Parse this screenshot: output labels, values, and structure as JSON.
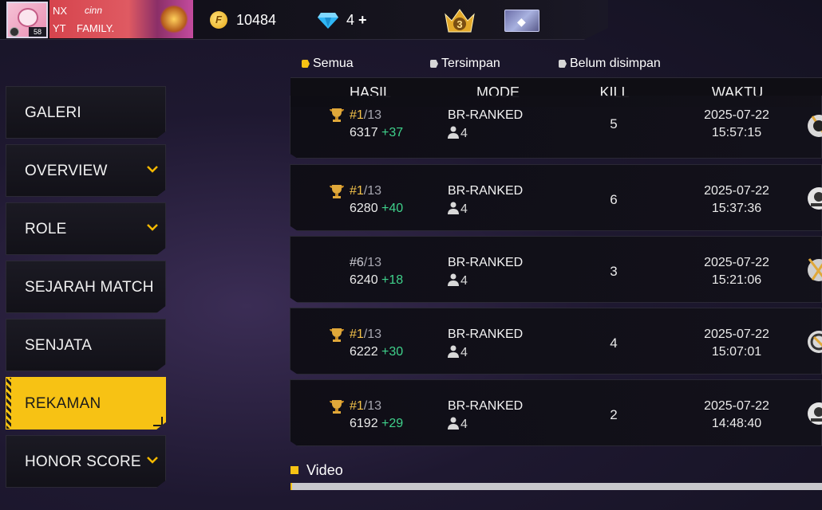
{
  "header": {
    "level": "58",
    "banner": {
      "line1_left": "NX",
      "line1_right": "cinn",
      "line2_left": "YT",
      "line2_right": "FAMILY."
    },
    "coins": "10484",
    "diamonds": "4",
    "diamonds_plus": "+",
    "rank_badge": "3",
    "icons": [
      "avatar",
      "coin-icon",
      "diamond-icon",
      "rank-crown-icon",
      "elite-card-icon"
    ]
  },
  "sidebar": {
    "items": [
      {
        "label": "GALERI",
        "expandable": false,
        "active": false
      },
      {
        "label": "OVERVIEW",
        "expandable": true,
        "active": false
      },
      {
        "label": "ROLE",
        "expandable": true,
        "active": false
      },
      {
        "label": "SEJARAH MATCH",
        "expandable": false,
        "active": false
      },
      {
        "label": "SENJATA",
        "expandable": false,
        "active": false
      },
      {
        "label": "REKAMAN",
        "expandable": false,
        "active": true
      },
      {
        "label": "HONOR SCORE",
        "expandable": true,
        "active": false
      }
    ],
    "chevron": "⌄"
  },
  "filters": {
    "all": "Semua",
    "saved": "Tersimpan",
    "unsaved": "Belum disimpan",
    "selected": "all"
  },
  "table": {
    "headers": {
      "result": "HASIL",
      "mode": "MODE",
      "kill": "KILL",
      "time": "WAKTU"
    },
    "rows": [
      {
        "pos": "#1",
        "total": "/13",
        "trophy": true,
        "points": "6317",
        "gain": "+37",
        "mode": "BR-RANKED",
        "squad": "4",
        "kill": "5",
        "date": "2025-07-22",
        "time": "15:57:15"
      },
      {
        "pos": "#1",
        "total": "/13",
        "trophy": true,
        "points": "6280",
        "gain": "+40",
        "mode": "BR-RANKED",
        "squad": "4",
        "kill": "6",
        "date": "2025-07-22",
        "time": "15:37:36"
      },
      {
        "pos": "#6",
        "total": "/13",
        "trophy": false,
        "points": "6240",
        "gain": "+18",
        "mode": "BR-RANKED",
        "squad": "4",
        "kill": "3",
        "date": "2025-07-22",
        "time": "15:21:06"
      },
      {
        "pos": "#1",
        "total": "/13",
        "trophy": true,
        "points": "6222",
        "gain": "+30",
        "mode": "BR-RANKED",
        "squad": "4",
        "kill": "4",
        "date": "2025-07-22",
        "time": "15:07:01"
      },
      {
        "pos": "#1",
        "total": "/13",
        "trophy": true,
        "points": "6192",
        "gain": "+29",
        "mode": "BR-RANKED",
        "squad": "4",
        "kill": "2",
        "date": "2025-07-22",
        "time": "14:48:40"
      }
    ]
  },
  "video": {
    "label": "Video",
    "progress": 0.003
  },
  "colors": {
    "accent": "#f7c214",
    "gain": "#3fd18b",
    "rank_gold": "#f3c24a"
  }
}
